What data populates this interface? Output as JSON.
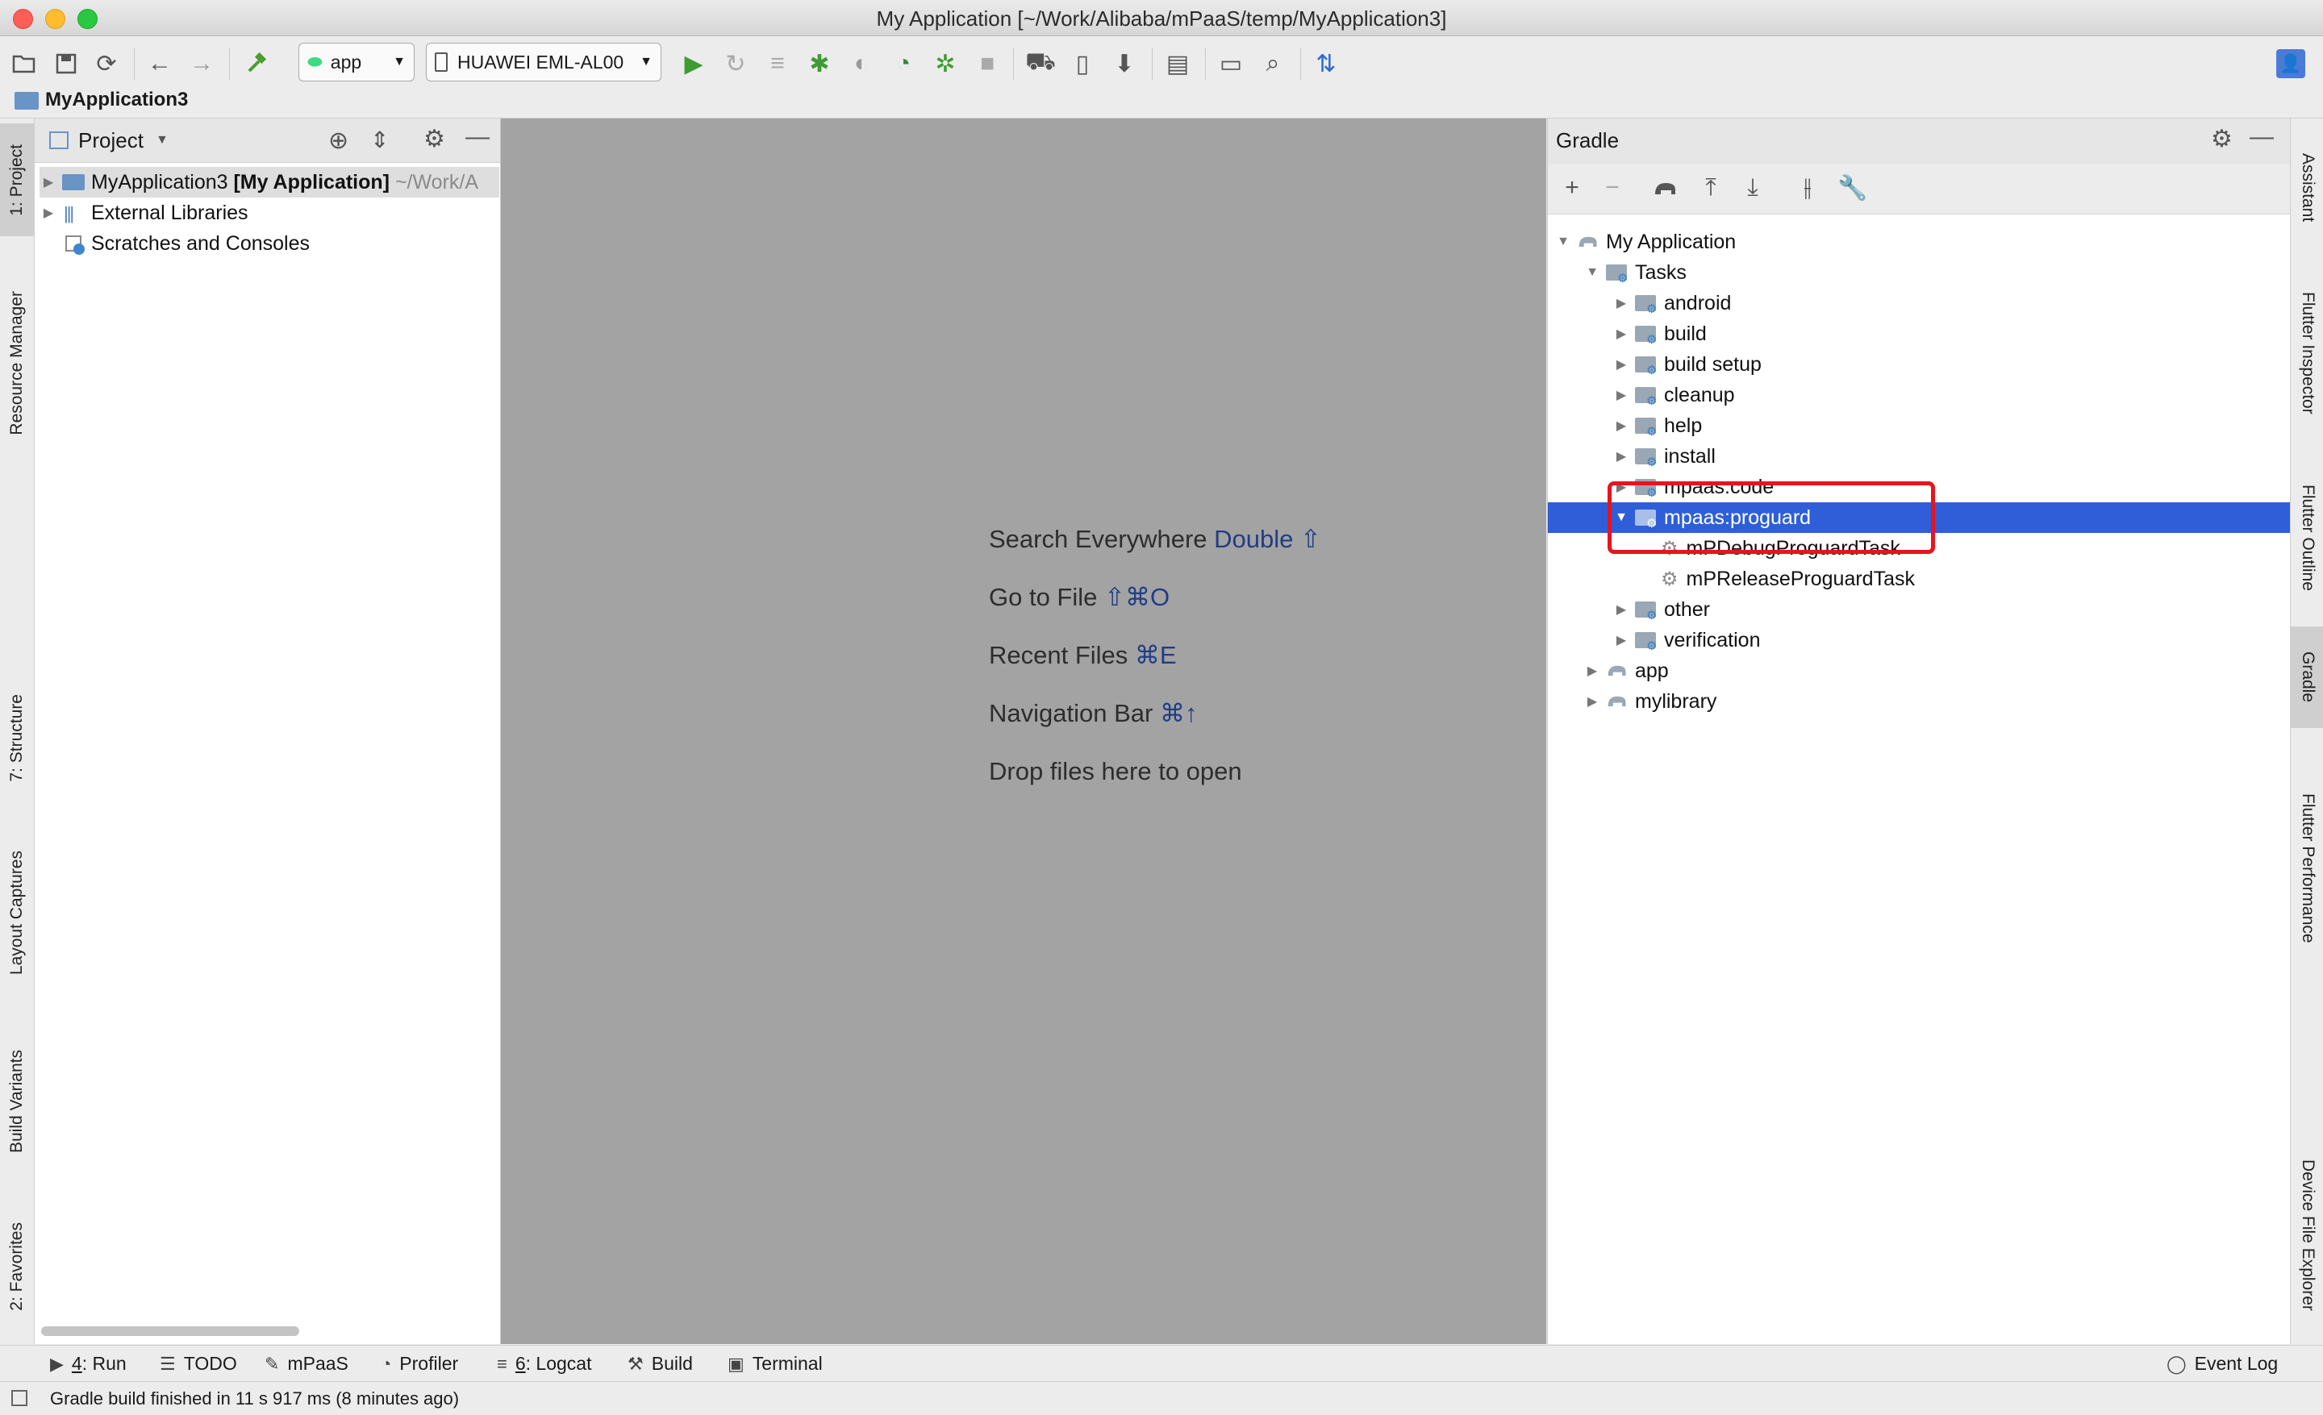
{
  "window": {
    "title": "My Application [~/Work/Alibaba/mPaaS/temp/MyApplication3]"
  },
  "toolbar": {
    "run_config": "app",
    "device": "HUAWEI EML-AL00"
  },
  "navbar": {
    "breadcrumb": "MyApplication3"
  },
  "left_stripe": {
    "tabs": [
      {
        "label": "1: Project"
      },
      {
        "label": "Resource Manager"
      },
      {
        "label": "7: Structure"
      },
      {
        "label": "Layout Captures"
      },
      {
        "label": "Build Variants"
      },
      {
        "label": "2: Favorites"
      }
    ]
  },
  "project_panel": {
    "header": "Project",
    "tree": [
      {
        "name": "MyApplication3",
        "bold": "[My Application]",
        "path": "~/Work/A"
      },
      {
        "name": "External Libraries"
      },
      {
        "name": "Scratches and Consoles"
      }
    ]
  },
  "editor": {
    "hints": [
      {
        "text": "Search Everywhere",
        "key": "Double ⇧"
      },
      {
        "text": "Go to File",
        "key": "⇧⌘O"
      },
      {
        "text": "Recent Files",
        "key": "⌘E"
      },
      {
        "text": "Navigation Bar",
        "key": "⌘↑"
      },
      {
        "text": "Drop files here to open",
        "key": ""
      }
    ]
  },
  "gradle_panel": {
    "header": "Gradle",
    "tree": {
      "root": "My Application",
      "tasks": "Tasks",
      "groups": [
        "android",
        "build",
        "build setup",
        "cleanup",
        "help",
        "install",
        "mpaas:code"
      ],
      "selected_group": "mpaas:proguard",
      "selected_tasks": [
        "mPDebugProguardTask",
        "mPReleaseProguardTask"
      ],
      "after_groups": [
        "other",
        "verification"
      ],
      "modules": [
        "app",
        "mylibrary"
      ]
    }
  },
  "right_stripe": {
    "tabs": [
      {
        "label": "Assistant"
      },
      {
        "label": "Flutter Inspector"
      },
      {
        "label": "Flutter Outline"
      },
      {
        "label": "Gradle"
      },
      {
        "label": "Flutter Performance"
      },
      {
        "label": "Device File Explorer"
      }
    ]
  },
  "bottom_tabs": [
    {
      "mnemonic": "4",
      "label": ": Run"
    },
    {
      "mnemonic": "",
      "label": "TODO"
    },
    {
      "mnemonic": "",
      "label": "mPaaS"
    },
    {
      "mnemonic": "",
      "label": "Profiler"
    },
    {
      "mnemonic": "6",
      "label": ": Logcat"
    },
    {
      "mnemonic": "",
      "label": "Build"
    },
    {
      "mnemonic": "",
      "label": "Terminal"
    }
  ],
  "event_log": "Event Log",
  "status": {
    "message": "Gradle build finished in 11 s 917 ms (8 minutes ago)"
  },
  "colors": {
    "selection": "#2f5ed8",
    "highlight_box": "#e8141c",
    "editor_bg": "#a3a3a3",
    "shortcut_text": "#203d85"
  }
}
